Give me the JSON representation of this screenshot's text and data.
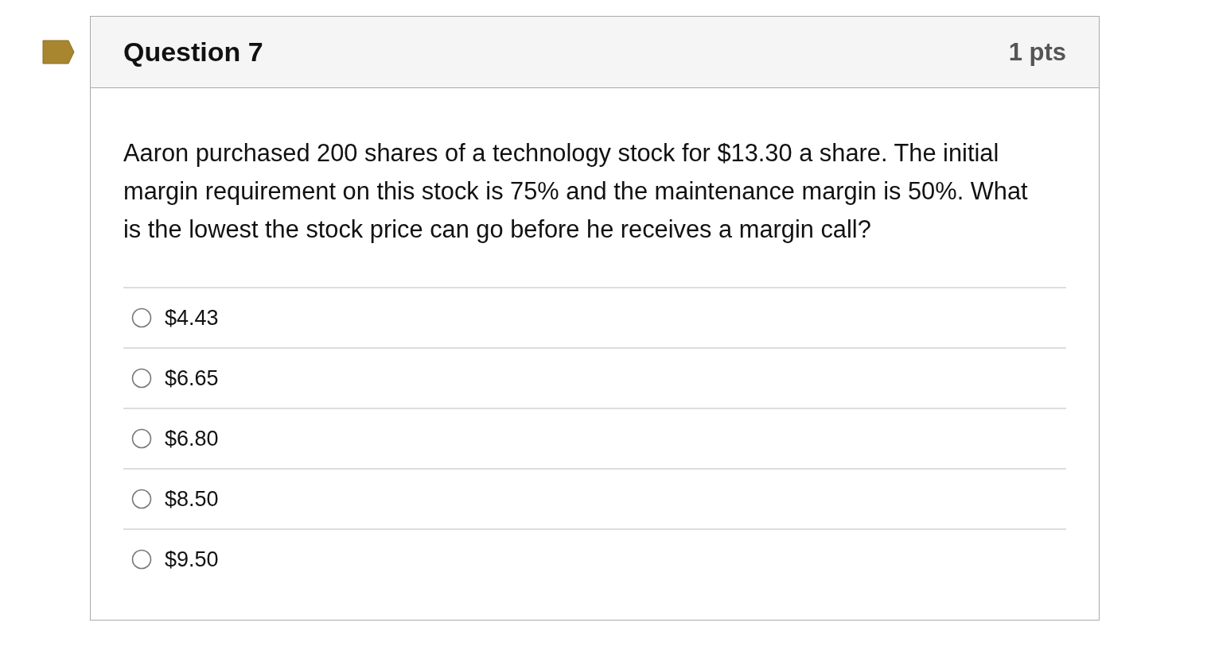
{
  "question": {
    "title": "Question 7",
    "points": "1 pts"
  },
  "prompt": "Aaron purchased 200 shares of a technology stock for $13.30 a share. The initial margin requirement on this stock is 75% and the maintenance margin is 50%. What is the lowest the stock price can go before he receives a margin call?",
  "answers": [
    {
      "label": "$4.43",
      "selected": false
    },
    {
      "label": "$6.65",
      "selected": false
    },
    {
      "label": "$6.80",
      "selected": false
    },
    {
      "label": "$8.50",
      "selected": false
    },
    {
      "label": "$9.50",
      "selected": false
    }
  ]
}
